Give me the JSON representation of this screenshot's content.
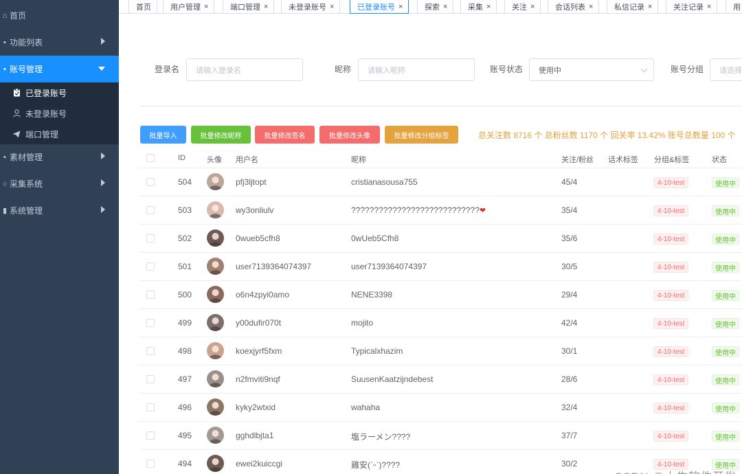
{
  "sidebar": {
    "items": [
      {
        "label": "首页",
        "icon": "home-icon"
      },
      {
        "label": "功能列表",
        "icon": "list-icon"
      },
      {
        "label": "账号管理",
        "icon": "user-icon"
      },
      {
        "label": "素材管理",
        "icon": "material-icon"
      },
      {
        "label": "采集系统",
        "icon": "search-icon"
      },
      {
        "label": "系统管理",
        "icon": "system-icon"
      }
    ],
    "submenu": [
      {
        "label": "已登录账号",
        "icon": "clipboard-icon"
      },
      {
        "label": "未登录账号",
        "icon": "user-outline-icon"
      },
      {
        "label": "端口管理",
        "icon": "send-icon"
      }
    ]
  },
  "tabs": [
    {
      "label": "首页",
      "closable": false
    },
    {
      "label": "用户管理",
      "closable": true
    },
    {
      "label": "端口管理",
      "closable": true
    },
    {
      "label": "未登录账号",
      "closable": true
    },
    {
      "label": "已登录账号",
      "closable": true,
      "active": true
    },
    {
      "label": "探索",
      "closable": true
    },
    {
      "label": "采集",
      "closable": true
    },
    {
      "label": "关注",
      "closable": true
    },
    {
      "label": "会话列表",
      "closable": true
    },
    {
      "label": "私信记录",
      "closable": true
    },
    {
      "label": "关注记录",
      "closable": true
    },
    {
      "label": "用",
      "closable": false
    }
  ],
  "tab_close_glyph": "×",
  "filters": {
    "login_name": {
      "label": "登录名",
      "placeholder": "请输入登录名"
    },
    "nickname": {
      "label": "昵称",
      "placeholder": "请输入昵称"
    },
    "status": {
      "label": "账号状态",
      "value": "使用中"
    },
    "group": {
      "label": "账号分组",
      "placeholder": "请选择"
    }
  },
  "buttons": {
    "import": "批量导入",
    "edit_nickname": "批量修改昵称",
    "edit_signature": "批量修改签名",
    "edit_avatar": "批量修改头像",
    "edit_group": "批量修改分组标签"
  },
  "colors": {
    "primary": "#409eff",
    "success": "#67c23a",
    "danger": "#f56c6c",
    "warning": "#e6a23c",
    "sidebar": "#304156",
    "active": "#1890ff"
  },
  "stats": "总关注数 8716 个 总粉丝数 1170 个 回关率 13.42% 账号总数量 100 个",
  "table": {
    "headers": {
      "id": "ID",
      "avatar": "头像",
      "username": "用户名",
      "nickname": "昵称",
      "follow": "关注/粉丝",
      "script_tag": "话术标签",
      "group_tag": "分组&标签",
      "status": "状态"
    },
    "rows": [
      {
        "id": "504",
        "username": "pfj3ljtopt",
        "nickname": "cristianasousa755",
        "follow": "45/4",
        "group": "4-10-test",
        "status": "使用中"
      },
      {
        "id": "503",
        "username": "wy3onliulv",
        "nickname": "????????????????????????????",
        "heart": "❤",
        "follow": "35/4",
        "group": "4-10-test",
        "status": "使用中"
      },
      {
        "id": "502",
        "username": "0wueb5cfh8",
        "nickname": "0wUeb5Cfh8",
        "follow": "35/6",
        "group": "4-10-test",
        "status": "使用中"
      },
      {
        "id": "501",
        "username": "user7139364074397",
        "nickname": "user7139364074397",
        "follow": "30/5",
        "group": "4-10-test",
        "status": "使用中"
      },
      {
        "id": "500",
        "username": "o6n4zpyi0amo",
        "nickname": "NENE3398",
        "follow": "29/4",
        "group": "4-10-test",
        "status": "使用中"
      },
      {
        "id": "499",
        "username": "y00dufir070t",
        "nickname": "mojito",
        "follow": "42/4",
        "group": "4-10-test",
        "status": "使用中"
      },
      {
        "id": "498",
        "username": "koexjyrf5fxm",
        "nickname": "Typicalxhazim",
        "follow": "30/1",
        "group": "4-10-test",
        "status": "使用中"
      },
      {
        "id": "497",
        "username": "n2fmviti9nqf",
        "nickname": "SuusenKaatzijndebest",
        "follow": "28/6",
        "group": "4-10-test",
        "status": "使用中"
      },
      {
        "id": "496",
        "username": "kyky2wtxid",
        "nickname": "wahaha",
        "follow": "32/4",
        "group": "4-10-test",
        "status": "使用中"
      },
      {
        "id": "495",
        "username": "gghdlbjta1",
        "nickname": "塩ラーメン????",
        "follow": "37/7",
        "group": "4-10-test",
        "status": "使用中"
      },
      {
        "id": "494",
        "username": "ewei2kuiccgi",
        "nickname": "雞安(ˊᵕˋ)????",
        "follow": "30/2",
        "group": "4-10-test",
        "status": "使用中"
      }
    ]
  },
  "watermark": "CSDN @大牛软件开发"
}
